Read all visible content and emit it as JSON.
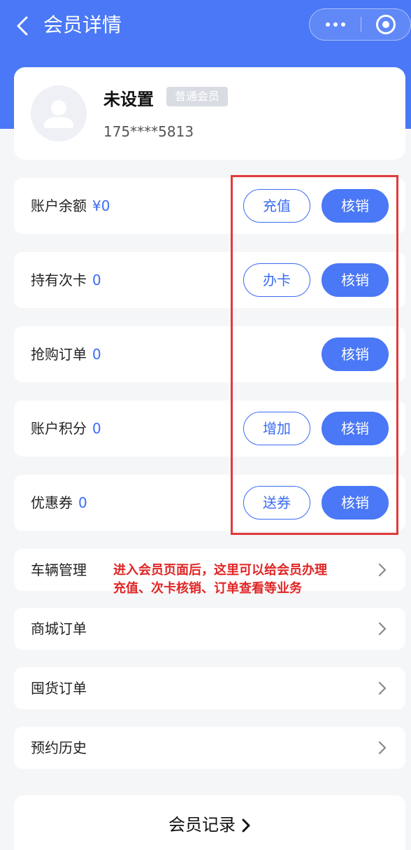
{
  "nav": {
    "title": "会员详情"
  },
  "profile": {
    "name": "未设置",
    "level": "普通会员",
    "phone": "175****5813"
  },
  "accounts": [
    {
      "label": "账户余额",
      "value": "¥0",
      "outline_btn": "充值",
      "solid_btn": "核销"
    },
    {
      "label": "持有次卡",
      "value": "0",
      "outline_btn": "办卡",
      "solid_btn": "核销"
    },
    {
      "label": "抢购订单",
      "value": "0",
      "outline_btn": null,
      "solid_btn": "核销"
    },
    {
      "label": "账户积分",
      "value": "0",
      "outline_btn": "增加",
      "solid_btn": "核销"
    },
    {
      "label": "优惠券",
      "value": "0",
      "outline_btn": "送券",
      "solid_btn": "核销"
    }
  ],
  "menu": [
    {
      "label": "车辆管理"
    },
    {
      "label": "商城订单"
    },
    {
      "label": "囤货订单"
    },
    {
      "label": "预约历史"
    }
  ],
  "annotation": {
    "line1": "进入会员页面后，这里可以给会员办理",
    "line2": "充值、次卡核销、订单查看等业务"
  },
  "footer": {
    "label": "会员记录"
  },
  "colors": {
    "primary": "#4a78f6",
    "accent_text": "#3a6cf4",
    "annotation": "#e02525",
    "highlight_border": "#e23a3a"
  }
}
